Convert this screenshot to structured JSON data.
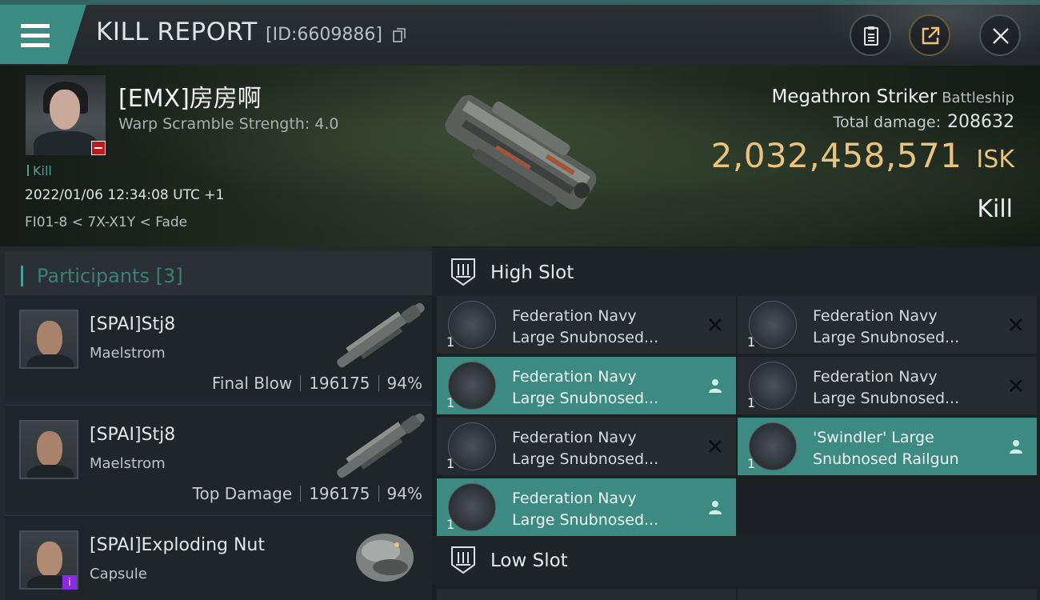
{
  "header": {
    "title": "KILL REPORT",
    "report_id": "[ID:6609886]",
    "menu_icon": "hamburger-menu-icon",
    "buttons": [
      {
        "name": "clipboard",
        "icon": "clipboard-icon"
      },
      {
        "name": "share",
        "icon": "share-icon"
      },
      {
        "name": "close",
        "icon": "close-icon"
      }
    ]
  },
  "victim": {
    "name": "[EMX]房房啊",
    "scramble": "Warp Scramble Strength: 4.0",
    "kill_tag": "Kill",
    "datetime": "2022/01/06 12:34:08 UTC +1",
    "location": "FI01-8 < 7X-X1Y < Fade",
    "standing_color": "#c0181b"
  },
  "ship": {
    "name": "Megathron Striker",
    "class": "Battleship",
    "damage_label": "Total damage:",
    "damage_value": "208632",
    "isk_value": "2,032,458,571",
    "isk_unit": "ISK",
    "result": "Kill"
  },
  "participants": {
    "label": "Participants",
    "count": "[3]",
    "rows": [
      {
        "name": "[SPAI]Stj8",
        "ship": "Maelstrom",
        "role": "Final Blow",
        "damage": "196175",
        "percent": "94%"
      },
      {
        "name": "[SPAI]Stj8",
        "ship": "Maelstrom",
        "role": "Top Damage",
        "damage": "196175",
        "percent": "94%"
      },
      {
        "name": "[SPAI]Exploding Nut",
        "ship": "Capsule",
        "role": "",
        "damage": "",
        "percent": ""
      }
    ]
  },
  "slots": {
    "high": {
      "label": "High Slot",
      "modules": [
        {
          "name": "Federation Navy\nLarge Snubnosed...",
          "qty": "1",
          "status": "destroyed"
        },
        {
          "name": "Federation Navy\nLarge Snubnosed...",
          "qty": "1",
          "status": "destroyed"
        },
        {
          "name": "Federation Navy\nLarge Snubnosed...",
          "qty": "1",
          "status": "dropped"
        },
        {
          "name": "Federation Navy\nLarge Snubnosed...",
          "qty": "1",
          "status": "destroyed"
        },
        {
          "name": "Federation Navy\nLarge Snubnosed...",
          "qty": "1",
          "status": "destroyed"
        },
        {
          "name": "'Swindler' Large\nSnubnosed Railgun",
          "qty": "1",
          "status": "dropped"
        },
        {
          "name": "Federation Navy\nLarge Snubnosed...",
          "qty": "1",
          "status": "dropped"
        }
      ]
    },
    "low": {
      "label": "Low Slot"
    }
  },
  "colors": {
    "accent": "#3a8b82",
    "isk": "#e9c37f",
    "dropped": "#3d8a82",
    "destroyed": "#262b30"
  }
}
